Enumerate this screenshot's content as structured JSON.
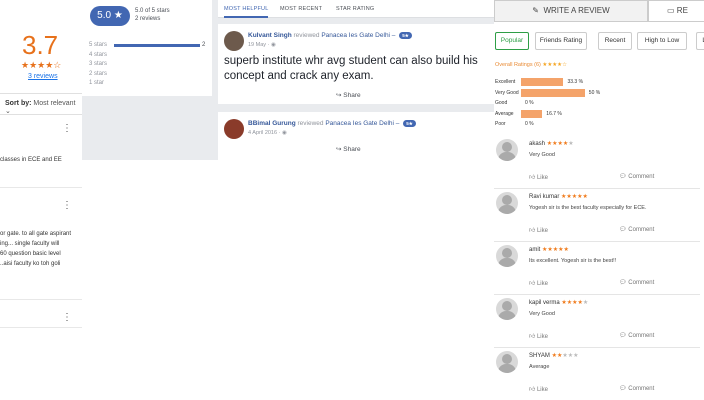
{
  "google": {
    "rating": "3.7",
    "stars": "★★★★☆",
    "reviews_link": "3 reviews",
    "sort_label": "Sort by:",
    "sort_value": "Most relevant",
    "snippets": [
      [
        "classes in ECE and EE"
      ],
      [
        "or gate. to all gate aspirant",
        "ing... single faculty will",
        "60 question basic level",
        "..aisi faculty ko toh goli"
      ]
    ]
  },
  "facebook": {
    "score": "5.0 ★",
    "score_text": "5.0 of 5 stars",
    "review_count": "2 reviews",
    "distribution": [
      {
        "label": "5 stars",
        "count": "2",
        "fraction": 1.0
      },
      {
        "label": "4 stars",
        "count": "",
        "fraction": 0
      },
      {
        "label": "3 stars",
        "count": "",
        "fraction": 0
      },
      {
        "label": "2 stars",
        "count": "",
        "fraction": 0
      },
      {
        "label": "1 star",
        "count": "",
        "fraction": 0
      }
    ],
    "tabs": [
      "Most Helpful",
      "Most Recent",
      "Star Rating"
    ],
    "posts": [
      {
        "author": "Kulvant Singh",
        "reviewed": "reviewed",
        "page": "Panacea Ies Gate Delhi –",
        "badge": "5★",
        "date": "19 May · ",
        "body": "superb institute whr avg student can also build his concept and crack any exam.",
        "share": "Share"
      },
      {
        "author": "BBimal Gurung",
        "reviewed": "reviewed",
        "page": "Panacea Ies Gate Delhi –",
        "badge": "5★",
        "date": "4 April 2016 · ",
        "body": "",
        "share": "Share"
      }
    ]
  },
  "site": {
    "write_review": "WRITE A REVIEW",
    "read_reviews": "RE",
    "filters": [
      "Popular",
      "Friends Rating",
      "Recent",
      "High to Low",
      "Lo"
    ],
    "overall_label": "Overall Ratings (6)",
    "overall_stars": "★★★★☆",
    "breakdown": [
      {
        "label": "Excellent",
        "pct": "33.3 %",
        "value": 33.3
      },
      {
        "label": "Very Good",
        "pct": "50 %",
        "value": 50
      },
      {
        "label": "Good",
        "pct": "0 %",
        "value": 0
      },
      {
        "label": "Average",
        "pct": "16.7 %",
        "value": 16.7
      },
      {
        "label": "Poor",
        "pct": "0 %",
        "value": 0
      }
    ],
    "like_label": "Like",
    "comment_label": "Comment",
    "reviews": [
      {
        "name": "akash",
        "stars": 4,
        "text": "Very Good"
      },
      {
        "name": "Ravi kumar",
        "stars": 5,
        "text": "Yogesh sir is the best faculty especially for ECE."
      },
      {
        "name": "amit",
        "stars": 5,
        "text": "Its excellent. Yogesh sir is the best!!"
      },
      {
        "name": "kapil verma",
        "stars": 4,
        "text": "Very Good"
      },
      {
        "name": "SHYAM",
        "stars": 2,
        "text": "Average"
      }
    ]
  },
  "colors": {
    "google_orange": "#e7711b",
    "fb_blue": "#4267b2",
    "bar_orange": "#f4a36a",
    "green": "#2e9e46"
  }
}
